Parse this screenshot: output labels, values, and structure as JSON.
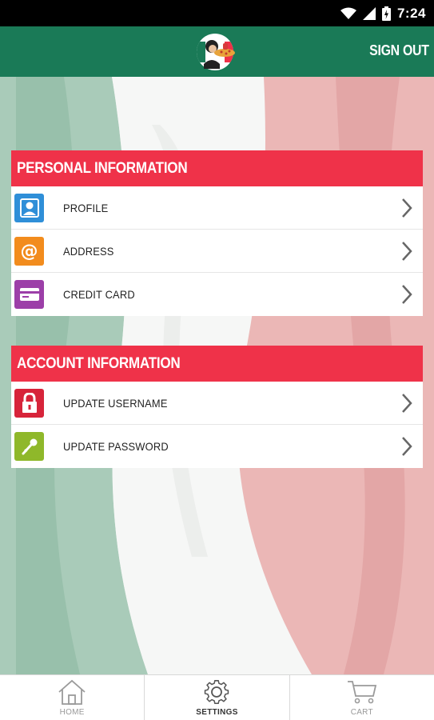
{
  "status_bar": {
    "time": "7:24"
  },
  "app_bar": {
    "sign_out_label": "SIGN OUT"
  },
  "sections": [
    {
      "header": "PERSONAL INFORMATION",
      "items": [
        {
          "label": "PROFILE",
          "icon": "profile-icon",
          "color": "#2f8fd8"
        },
        {
          "label": "ADDRESS",
          "icon": "at-sign-icon",
          "color": "#f28c1d"
        },
        {
          "label": "CREDIT CARD",
          "icon": "credit-card-icon",
          "color": "#9c3fa8"
        }
      ]
    },
    {
      "header": "ACCOUNT INFORMATION",
      "items": [
        {
          "label": "UPDATE USERNAME",
          "icon": "lock-icon",
          "color": "#d7243a"
        },
        {
          "label": "UPDATE PASSWORD",
          "icon": "key-icon",
          "color": "#8fb82a"
        }
      ]
    }
  ],
  "bottom_nav": [
    {
      "label": "HOME",
      "icon": "home-icon",
      "active": false
    },
    {
      "label": "SETTINGS",
      "icon": "gear-icon",
      "active": true
    },
    {
      "label": "CART",
      "icon": "cart-icon",
      "active": false
    }
  ],
  "colors": {
    "app_bar": "#1a7a57",
    "section_header": "#ef3249",
    "flag_green": "#6fa88a",
    "flag_white": "#f1f1f1",
    "flag_red": "#e28b8b"
  }
}
